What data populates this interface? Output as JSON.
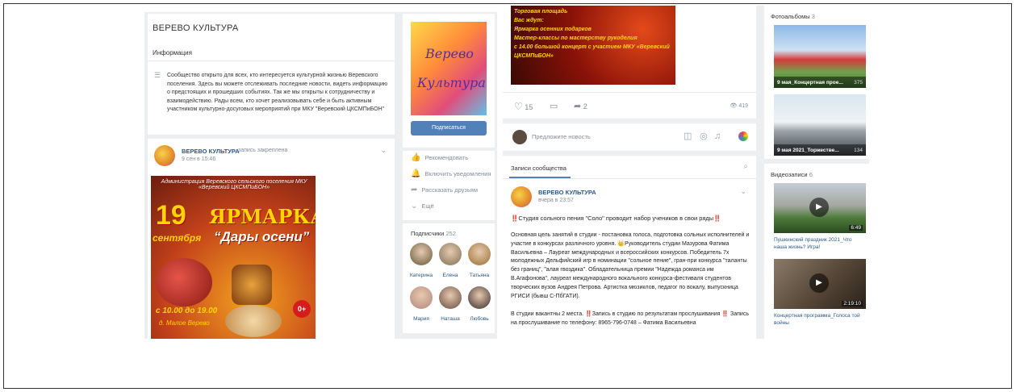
{
  "community": {
    "name": "ВЕРЕВО КУЛЬТУРА",
    "info_tab": "Информация",
    "description": "Сообщество открыто для всех, кто интересуется культурной жизнью Веревского поселения. Здесь вы можете отслеживать последние новости, видеть информацию о предстоящих и прошедших событиях. Так же мы открыты к сотрудничеству и взаимодействию. Рады всем, кто хочет реализовывать себе и быть активным участником культурно-досуговых мероприятий при МКУ \"Веревский ЦКСМПиБОН\"",
    "logo_line1": "Верево",
    "logo_line2": "Культура"
  },
  "pinned_post": {
    "author": "ВЕРЕВО КУЛЬТУРА",
    "action": "запись закреплена",
    "date": "9 сен в 15:46",
    "poster": {
      "org": "Администрация Веревского сельского поселения МКУ «Веревский ЦКСМПиБОН»",
      "day": "19",
      "month": "сентября",
      "title": "ЯРМАРКА",
      "subtitle": "“Дары осени”",
      "time": "с 10.00 до 19.00",
      "place": "д. Малое Верево",
      "age": "0+"
    }
  },
  "side_actions": {
    "subscribe": "Подписаться",
    "items": [
      {
        "icon": "thumb-up-icon",
        "label": "Рекомендовать"
      },
      {
        "icon": "bell-icon",
        "label": "Включить уведомления"
      },
      {
        "icon": "share-icon",
        "label": "Рассказать друзьям"
      },
      {
        "icon": "chevron-down-icon",
        "label": "Ещё"
      }
    ]
  },
  "subscribers": {
    "label": "Подписчики",
    "count": "252",
    "people": [
      {
        "name": "Катерина",
        "color": "#8a7a5a"
      },
      {
        "name": "Елена",
        "color": "#9c8a70"
      },
      {
        "name": "Татьяна",
        "color": "#b08a55"
      },
      {
        "name": "Мария",
        "color": "#c29a8a"
      },
      {
        "name": "Наташа",
        "color": "#8a7060"
      },
      {
        "name": "Любовь",
        "color": "#6a5a50"
      }
    ]
  },
  "top_post": {
    "text_lines": [
      "Торговая площадь",
      "Вас ждут:",
      "Ярмарка осенних подарков",
      "Мастер-классы по мастерству рукоделия",
      "с 14.00 большой концерт с участием МКУ «Веревский ЦКСМПиБОН»"
    ],
    "likes": "15",
    "shares": "2",
    "views": "419"
  },
  "suggest": {
    "placeholder": "Предложите новость"
  },
  "wall": {
    "tab": "Записи сообщества",
    "post": {
      "author": "ВЕРЕВО КУЛЬТУРА",
      "date": "вчера в 23:57",
      "headline": "‼️Студия сольного пения \"Соло\" проводит набор учеников в свои ряды‼️",
      "p1": "Основная цель занятий в студии - постановка голоса, подготовка сольных исполнителей и участие в конкурсах различного уровня. 👑Руководитель студии Мазурова Фатима Васильевна – Лауреат международных и всероссийских конкурсов. Победитель 7х молодежных Дельфийский игр в номинации \"сольное пение\", гран-при конкурса \"таланты без границ\", \"алая гвоздика\". Обладательница премии \"Надежда романса им В.Агафонова\", лауреат международного вокального конкурса-фестиваля студентов творческих вузов Андрея Петрова. Артистка мюзиклов, педагог по вокалу, выпускница РГИСИ (бывш С-ПбГАТИ).",
      "p2": "В студии вакантны 2 места. ‼️Запись в студию по результатам прослушивания ‼️ Запись на прослушивание по телефону: 8965-796-0748 – Фатима Васильевна"
    }
  },
  "photos": {
    "label": "Фотоальбомы",
    "count": "3",
    "albums": [
      {
        "title": "9 мая_Концертная прое...",
        "count": "375"
      },
      {
        "title": "9 мая 2021_Торжестве...",
        "count": "134"
      }
    ]
  },
  "videos": {
    "label": "Видеозаписи",
    "count": "6",
    "items": [
      {
        "duration": "6:49",
        "title": "Пушкинский праздник 2021_Что наша жизнь? Игра!"
      },
      {
        "duration": "2:19:10",
        "title": "Концертная программа_Голоса той войны"
      }
    ]
  },
  "colors": {
    "vk_blue": "#5181b8",
    "link": "#2a5885",
    "bg": "#edeef0",
    "attention": "#e64646"
  }
}
